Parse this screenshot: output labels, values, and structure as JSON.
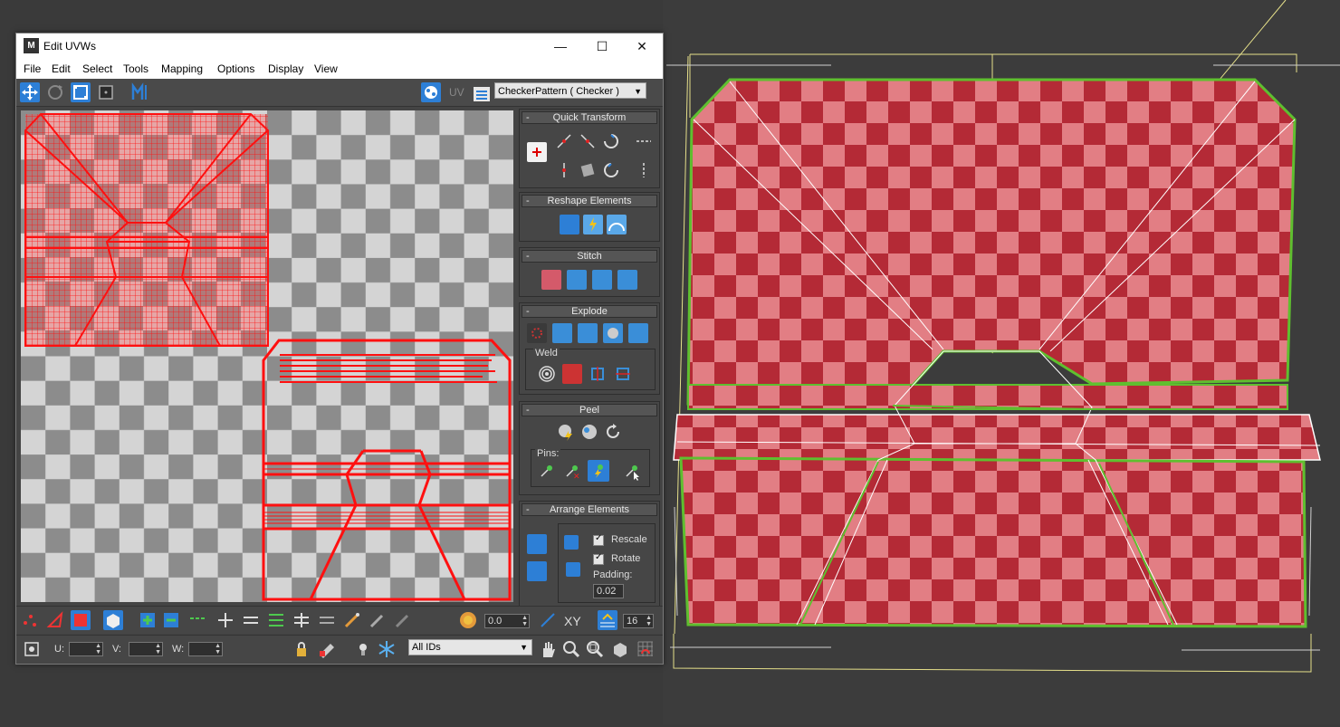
{
  "window": {
    "title": "Edit UVWs",
    "app_icon_label": "M",
    "minimize_icon": "minimize-icon",
    "maximize_icon": "maximize-icon",
    "close_icon": "close-icon"
  },
  "menu": {
    "items": [
      "File",
      "Edit",
      "Select",
      "Tools",
      "Mapping",
      "Options",
      "Display",
      "View"
    ]
  },
  "toolbar": {
    "uv_label": "UV",
    "texture_select_value": "CheckerPattern  ( Checker )"
  },
  "panel": {
    "quick_transform": "Quick Transform",
    "reshape_elements": "Reshape Elements",
    "stitch": "Stitch",
    "explode": "Explode",
    "weld": "Weld",
    "peel": "Peel",
    "pins": "Pins:",
    "arrange_elements": "Arrange Elements",
    "rescale": "Rescale",
    "rotate": "Rotate",
    "padding_label": "Padding:",
    "padding_value": "0.02",
    "rollout_minus": "-"
  },
  "bottom_bar": {
    "soft_value": "0.0",
    "xy_label": "XY",
    "grid_value": "16",
    "u_label": "U:",
    "v_label": "V:",
    "w_label": "W:",
    "ids_select_value": "All IDs"
  },
  "colors": {
    "uv_wire": "#ff1010",
    "checker_dark": "#b42a36",
    "checker_light": "#e27e84",
    "accent_blue": "#2d7fd6",
    "mesh_edge_green": "#5fbf2f",
    "gizmo_yellow": "#e6e08a"
  }
}
